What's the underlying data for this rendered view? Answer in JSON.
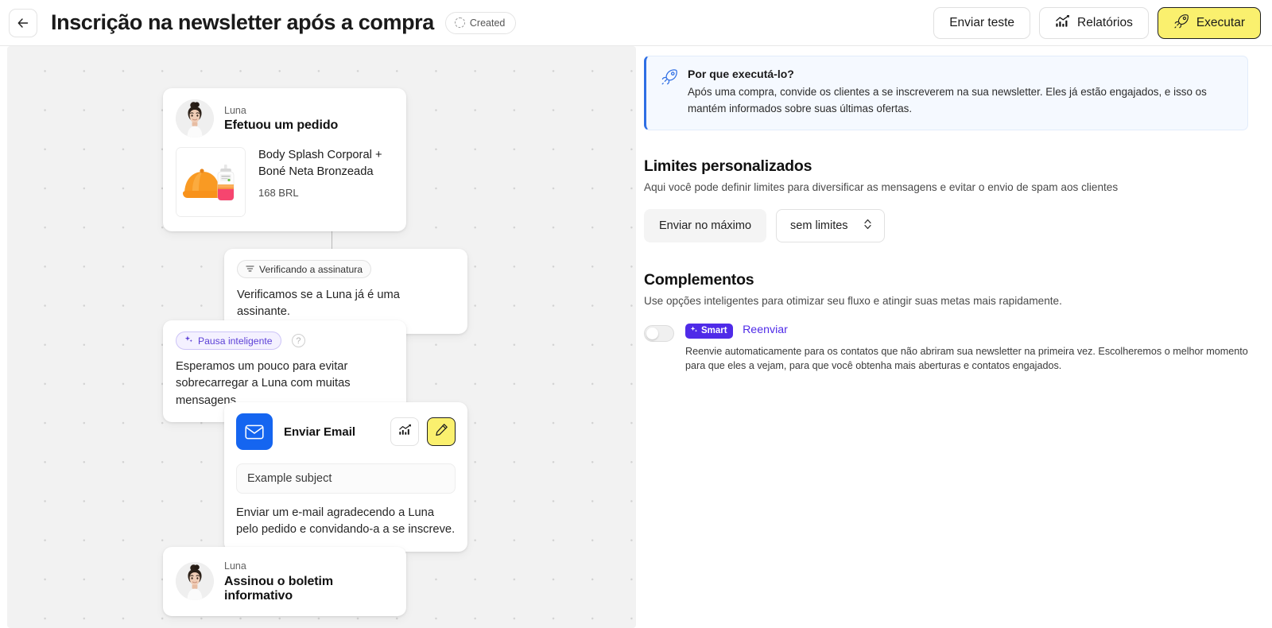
{
  "header": {
    "back_icon": "arrow-left-icon",
    "title": "Inscrição na newsletter após a compra",
    "status": "Created",
    "status_icon": "dashed-circle-icon",
    "actions": {
      "send_test": "Enviar teste",
      "reports": "Relatórios",
      "reports_icon": "chart-icon",
      "run": "Executar",
      "run_icon": "rocket-icon"
    }
  },
  "flow": {
    "trigger_node": {
      "person_name": "Luna",
      "action": "Efetuou um pedido",
      "avatar": "avatar-luna",
      "product": {
        "image": "product-image-bodysplash-cap",
        "title": "Body Splash Corporal + Boné Neta Bronzeada",
        "price": "168 BRL"
      }
    },
    "condition_node": {
      "badge": "Verificando a assinatura",
      "badge_icon": "filter-icon",
      "text": "Verificamos se a Luna já é uma assinante."
    },
    "delay_node": {
      "badge": "Pausa inteligente",
      "badge_icon": "sparkle-icon",
      "help_icon": "help-circle-icon",
      "help_label": "?",
      "text": "Esperamos um pouco para evitar sobrecarregar a Luna com muitas mensagens."
    },
    "email_node": {
      "icon": "envelope-icon",
      "label": "Enviar Email",
      "stats_icon": "chart-icon",
      "edit_icon": "pencil-icon",
      "subject": "Example subject",
      "description": "Enviar um e-mail agradecendo a Luna pelo pedido e convidando-a a se inscreve."
    },
    "goal_node": {
      "person_name": "Luna",
      "action": "Assinou o boletim informativo",
      "avatar": "avatar-luna"
    }
  },
  "panel": {
    "info_banner": {
      "icon": "rocket-icon",
      "title": "Por que executá-lo?",
      "text": "Após uma compra, convide os clientes a se inscreverem na sua newsletter. Eles já estão engajados, e isso os mantém informados sobre suas últimas ofertas."
    },
    "limits": {
      "title": "Limites personalizados",
      "subtitle": "Aqui você pode definir limites para diversificar as mensagens e evitar o envio de spam aos clientes",
      "label": "Enviar no máximo",
      "select_value": "sem limites",
      "select_icon": "chevron-updown-icon"
    },
    "addons": {
      "title": "Complementos",
      "subtitle": "Use opções inteligentes para otimizar seu fluxo e atingir suas metas mais rapidamente.",
      "items": [
        {
          "toggle_state": "off",
          "badge": "Smart",
          "badge_icon": "sparkle-icon",
          "name": "Reenviar",
          "description": "Reenvie automaticamente para os contatos que não abriram sua newsletter na primeira vez. Escolheremos o melhor momento para que eles a vejam, para que você obtenha mais aberturas e contatos engajados."
        }
      ]
    }
  },
  "colors": {
    "accent_yellow": "#FAF06E",
    "brand_purple": "#4F2BE8",
    "info_blue": "#2f6fe4",
    "email_blue": "#1565f0"
  }
}
